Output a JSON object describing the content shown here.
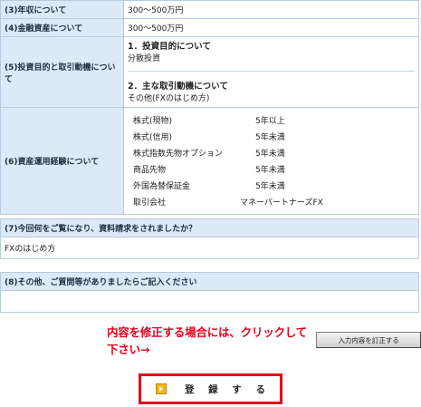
{
  "profile": {
    "rows": [
      {
        "label": "(3)年収について",
        "value": "300～500万円"
      },
      {
        "label": "(4)金融資産について",
        "value": "300～500万円"
      }
    ],
    "purpose": {
      "label": "(5)投資目的と取引動機について",
      "sections": [
        {
          "title": "1．投資目的について",
          "value": "分散投資"
        },
        {
          "title": "2．主な取引動機について",
          "value": "その他(FXのはじめ方)"
        }
      ]
    },
    "experience": {
      "label": "(6)資産運用経験について",
      "items": [
        {
          "name": "株式(現物)",
          "years": "5年以上"
        },
        {
          "name": "株式(信用)",
          "years": "5年未満"
        },
        {
          "name": "株式指数先物オプション",
          "years": "5年未満"
        },
        {
          "name": "商品先物",
          "years": "5年未満"
        },
        {
          "name": "外国為替保証金",
          "years": "5年未満"
        }
      ],
      "broker_label": "取引会社",
      "broker_value": "マネーパートナーズFX"
    }
  },
  "q7": {
    "question": "(7)今回何をご覧になり、資料請求をされましたか？",
    "answer": "FXのはじめ方"
  },
  "q8": {
    "question": "(8)その他、ご質問等がありましたらご記入ください",
    "answer": ""
  },
  "correction": {
    "message": "内容を修正する場合には、クリックして下さい→",
    "button_label": "入力内容を訂正する"
  },
  "submit": {
    "label": "登 録 す る",
    "icon": "play-arrow-icon"
  },
  "colors": {
    "header_bg": "#dce9f7",
    "border": "#b7cbe0",
    "accent_red": "#e10f1a"
  }
}
